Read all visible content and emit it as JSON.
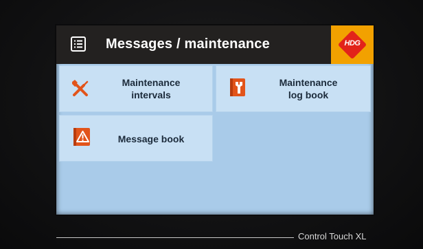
{
  "header": {
    "title": "Messages / maintenance",
    "logo_text": "HDG"
  },
  "tiles": [
    {
      "label": "Maintenance\nintervals",
      "icon": "tools-icon"
    },
    {
      "label": "Maintenance\nlog book",
      "icon": "wrench-book-icon"
    },
    {
      "label": "Message book",
      "icon": "warning-book-icon"
    }
  ],
  "device": {
    "brand": "Control Touch XL"
  },
  "colors": {
    "header_bg": "#232120",
    "screen_bg": "#a9cbe9",
    "tile_bg": "#c8e0f4",
    "accent_orange": "#f2a100",
    "icon_orange": "#e2541a",
    "logo_red": "#e2231a"
  }
}
